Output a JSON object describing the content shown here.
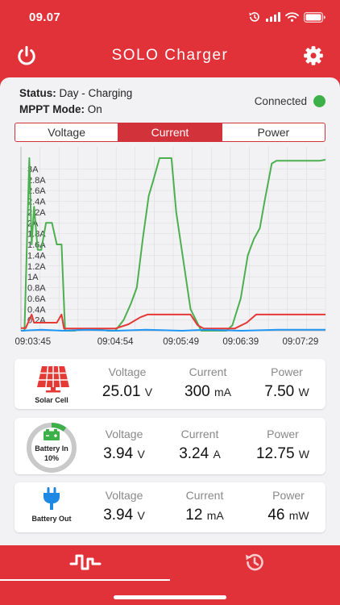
{
  "status_bar": {
    "time": "09.07"
  },
  "header": {
    "title": "SOLO Charger",
    "power_icon": "power-icon",
    "settings_icon": "gear-icon"
  },
  "status": {
    "status_label": "Status:",
    "status_value": "Day - Charging",
    "mppt_label": "MPPT Mode:",
    "mppt_value": "On",
    "connection": "Connected",
    "connection_color": "#3db04a"
  },
  "tabs": [
    {
      "label": "Voltage",
      "active": false
    },
    {
      "label": "Current",
      "active": true
    },
    {
      "label": "Power",
      "active": false
    }
  ],
  "chart_data": {
    "type": "line",
    "title": "",
    "xlabel": "",
    "ylabel": "",
    "ylim": [
      0,
      3.2
    ],
    "x_range": [
      "09:03:35",
      "09:07:50"
    ],
    "x_ticks": [
      "09:03:45",
      "09:04:54",
      "09:05:49",
      "09:06:39",
      "09:07:29"
    ],
    "y_ticks": [
      "0.2A",
      "0.4A",
      "0.6A",
      "0.8A",
      "1A",
      "1.2A",
      "1.4A",
      "1.6A",
      "1.8A",
      "2A",
      "2.2A",
      "2.4A",
      "2.6A",
      "2.8A",
      "3A"
    ],
    "grid": true,
    "series": [
      {
        "color": "#4caf50",
        "points": [
          [
            "09:03:35",
            0
          ],
          [
            "09:03:38",
            0
          ],
          [
            "09:03:42",
            3.2
          ],
          [
            "09:03:44",
            1.6
          ],
          [
            "09:03:46",
            2.3
          ],
          [
            "09:03:49",
            1.5
          ],
          [
            "09:03:52",
            1.5
          ],
          [
            "09:03:56",
            2.0
          ],
          [
            "09:04:01",
            2.0
          ],
          [
            "09:04:05",
            1.6
          ],
          [
            "09:04:09",
            1.6
          ],
          [
            "09:04:12",
            0
          ],
          [
            "09:04:20",
            0
          ],
          [
            "09:04:25",
            0.03
          ],
          [
            "09:04:38",
            0.03
          ],
          [
            "09:04:48",
            0
          ],
          [
            "09:04:54",
            0
          ],
          [
            "09:05:01",
            0.2
          ],
          [
            "09:05:07",
            0.5
          ],
          [
            "09:05:12",
            0.8
          ],
          [
            "09:05:17",
            1.7
          ],
          [
            "09:05:22",
            2.5
          ],
          [
            "09:05:26",
            2.8
          ],
          [
            "09:05:31",
            3.2
          ],
          [
            "09:05:41",
            3.2
          ],
          [
            "09:05:45",
            2.2
          ],
          [
            "09:05:49",
            1.6
          ],
          [
            "09:05:57",
            0.4
          ],
          [
            "09:06:06",
            0
          ],
          [
            "09:06:20",
            0
          ],
          [
            "09:06:27",
            0
          ],
          [
            "09:06:32",
            0.1
          ],
          [
            "09:06:39",
            0.6
          ],
          [
            "09:06:45",
            1.4
          ],
          [
            "09:06:50",
            1.7
          ],
          [
            "09:06:55",
            1.9
          ],
          [
            "09:06:59",
            2.4
          ],
          [
            "09:07:05",
            3.1
          ],
          [
            "09:07:09",
            3.15
          ],
          [
            "09:07:29",
            3.15
          ],
          [
            "09:07:45",
            3.15
          ],
          [
            "09:07:50",
            3.17
          ]
        ]
      },
      {
        "color": "#e53935",
        "points": [
          [
            "09:03:35",
            0.05
          ],
          [
            "09:03:39",
            0.05
          ],
          [
            "09:03:44",
            0.3
          ],
          [
            "09:03:46",
            0.15
          ],
          [
            "09:04:05",
            0.15
          ],
          [
            "09:04:09",
            0.3
          ],
          [
            "09:04:11",
            0.04
          ],
          [
            "09:04:54",
            0.04
          ],
          [
            "09:05:05",
            0.12
          ],
          [
            "09:05:15",
            0.25
          ],
          [
            "09:05:21",
            0.3
          ],
          [
            "09:05:57",
            0.3
          ],
          [
            "09:06:03",
            0.1
          ],
          [
            "09:06:08",
            0.04
          ],
          [
            "09:06:34",
            0.04
          ],
          [
            "09:06:44",
            0.15
          ],
          [
            "09:06:52",
            0.3
          ],
          [
            "09:07:50",
            0.3
          ]
        ]
      },
      {
        "color": "#2196f3",
        "points": [
          [
            "09:03:35",
            0.0
          ],
          [
            "09:03:52",
            0.02
          ],
          [
            "09:04:10",
            0.0
          ],
          [
            "09:04:30",
            0.02
          ],
          [
            "09:04:55",
            0.0
          ],
          [
            "09:05:20",
            0.02
          ],
          [
            "09:05:50",
            0.0
          ],
          [
            "09:06:10",
            0.02
          ],
          [
            "09:06:40",
            0.0
          ],
          [
            "09:07:10",
            0.02
          ],
          [
            "09:07:50",
            0.02
          ]
        ]
      }
    ]
  },
  "cards": [
    {
      "label": "Solar Cell",
      "icon": "solar-panel-icon",
      "icon_color": "#e53935",
      "metrics": [
        {
          "label": "Voltage",
          "value": "25.01",
          "unit": "V"
        },
        {
          "label": "Current",
          "value": "300",
          "unit": "mA"
        },
        {
          "label": "Power",
          "value": "7.50",
          "unit": "W"
        }
      ]
    },
    {
      "label": "Battery In",
      "sub_label": "10%",
      "icon": "battery-icon",
      "icon_color": "#3db04a",
      "charge_fraction": 0.1,
      "metrics": [
        {
          "label": "Voltage",
          "value": "3.94",
          "unit": "V"
        },
        {
          "label": "Current",
          "value": "3.24",
          "unit": "A"
        },
        {
          "label": "Power",
          "value": "12.75",
          "unit": "W"
        }
      ]
    },
    {
      "label": "Battery Out",
      "icon": "plug-icon",
      "icon_color": "#1e88e5",
      "metrics": [
        {
          "label": "Voltage",
          "value": "3.94",
          "unit": "V"
        },
        {
          "label": "Current",
          "value": "12",
          "unit": "mA"
        },
        {
          "label": "Power",
          "value": "46",
          "unit": "mW"
        }
      ]
    }
  ],
  "bottom_nav": [
    {
      "name": "live",
      "icon": "waveform-icon",
      "active": true
    },
    {
      "name": "history",
      "icon": "history-icon",
      "active": false
    }
  ]
}
